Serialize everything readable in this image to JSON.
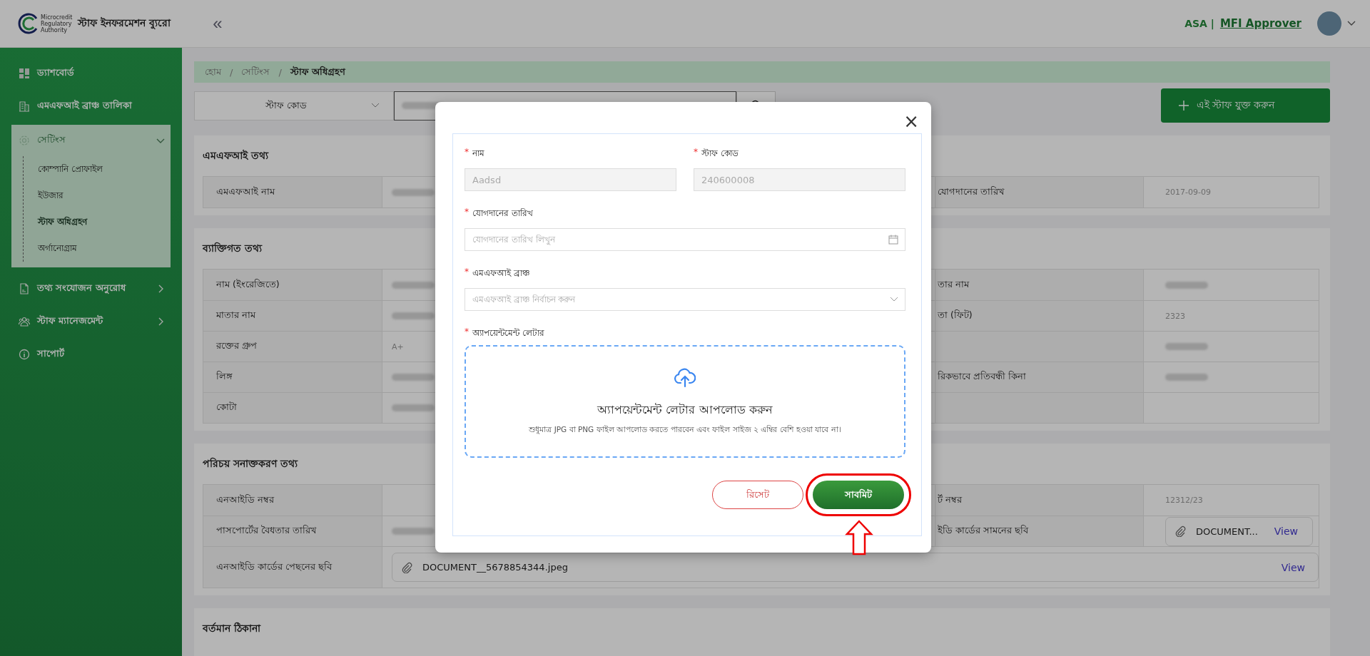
{
  "header": {
    "logo_lines": [
      "Microcredit",
      "Regulatory",
      "Authority"
    ],
    "title": "স্টাফ ইনফরমেশন ব্যুরো",
    "collapse": "«",
    "org": "ASA |",
    "role": "MFI Approver"
  },
  "sidebar": {
    "items": [
      {
        "kind": "dashboard",
        "label": "ড্যাশবোর্ড"
      },
      {
        "kind": "building",
        "label": "এমএফআই ব্রাঞ্চ তালিকা"
      },
      {
        "kind": "settings",
        "label": "সেটিংস",
        "expanded": true,
        "children": [
          {
            "label": "কোম্পানি প্রোফাইল",
            "selected": false
          },
          {
            "label": "ইউজার",
            "selected": false
          },
          {
            "label": "স্টাফ অধিগ্রহণ",
            "selected": true
          },
          {
            "label": "অর্গানোগ্রাম",
            "selected": false
          }
        ]
      },
      {
        "kind": "document",
        "label": "তথ্য সংযোজন অনুরোধ",
        "expanded": false
      },
      {
        "kind": "people",
        "label": "স্টাফ ম্যানেজমেন্ট",
        "expanded": false
      },
      {
        "kind": "info",
        "label": "সাপোর্ট"
      }
    ]
  },
  "breadcrumb": {
    "separator": "/",
    "items": [
      "হোম",
      "সেটিংস",
      "স্টাফ অধিগ্রহণ"
    ]
  },
  "search": {
    "field": "স্টাফ কোড",
    "value_redacted": true
  },
  "add_button": {
    "label": "এই স্টাফ যুক্ত করুন"
  },
  "sections": [
    {
      "title": "এমএফআই তথ্য",
      "rows": [
        {
          "label": "এমএফআই নাম",
          "value": {
            "kind": "redacted"
          },
          "right_label": "যোগদানের তারিখ",
          "right_value": {
            "kind": "text",
            "text": "2017-09-09"
          }
        }
      ]
    },
    {
      "title": "ব্যাক্তিগত তথ্য",
      "rows": [
        {
          "label": "নাম (ইংরেজিতে)",
          "value": {
            "kind": "redacted"
          },
          "right_label": "তার নাম",
          "right_value": {
            "kind": "redacted"
          }
        },
        {
          "label": "মাতার নাম",
          "value": {
            "kind": "redacted"
          },
          "right_label": "তা (ফিট)",
          "right_value": {
            "kind": "text",
            "text": "2323"
          }
        },
        {
          "label": "রক্তের গ্রুপ",
          "value": {
            "kind": "text",
            "text": "A+"
          },
          "right_value": {
            "kind": "redacted"
          }
        },
        {
          "label": "লিঙ্গ",
          "value": {
            "kind": "redacted"
          },
          "right_label": "রিকভাবে প্রতিবন্ধী কিনা",
          "right_value": {
            "kind": "redacted"
          }
        },
        {
          "label": "কোটা",
          "value": {
            "kind": "redacted"
          }
        }
      ]
    },
    {
      "title": "পরিচয় সনাক্তকরণ তথ্য",
      "rows": [
        {
          "label": "এনআইডি নম্বর",
          "right_label": "র্ট নম্বর",
          "right_value": {
            "kind": "text",
            "text": "12312/23"
          }
        },
        {
          "label": "পাসপোর্টের বৈধতার তারিখ",
          "value": {
            "kind": "redacted"
          },
          "right_label": "ইডি কার্ডের সামনের ছবি",
          "right_value": {
            "kind": "document",
            "file": "DOCUMENT...",
            "link": "View"
          }
        },
        {
          "label": "এনআইডি কার্ডের পেছনের ছবি",
          "wide": true,
          "value": {
            "kind": "document",
            "file": "DOCUMENT__5678854344.jpeg",
            "link": "View"
          }
        }
      ]
    },
    {
      "title": "বর্তমান ঠিকানা"
    }
  ],
  "modal": {
    "close": "×",
    "fields": [
      {
        "kind": "readonly",
        "label": "নাম",
        "required": true,
        "value": "Aadsd"
      },
      {
        "kind": "readonly",
        "label": "স্টাফ কোড",
        "required": true,
        "value": "240600008"
      },
      {
        "kind": "date",
        "label": "যোগদানের তারিখ",
        "required": true,
        "placeholder": "যোগদানের তারিখ লিখুন"
      },
      {
        "kind": "select",
        "label": "এমএফআই ব্রাঞ্চ",
        "required": true,
        "placeholder": "এমএফআই ব্রাঞ্চ নির্বাচন করুন"
      },
      {
        "kind": "upload",
        "label": "অ্যাপয়েন্টমেন্ট লেটার",
        "required": true,
        "title": "অ্যাপয়েন্টমেন্ট লেটার আপলোড করুন",
        "hint": "শুধুমাত্র JPG বা PNG ফাইল আপলোড করতে পারবেন এবং ফাইল সাইজ ২ এম্বির বেশি হওয়া যাবে না।"
      }
    ],
    "required_mark": "*",
    "buttons": [
      {
        "kind": "outline",
        "label": "রিসেট"
      },
      {
        "kind": "primary",
        "label": "সাবমিট",
        "highlighted": true
      }
    ]
  }
}
